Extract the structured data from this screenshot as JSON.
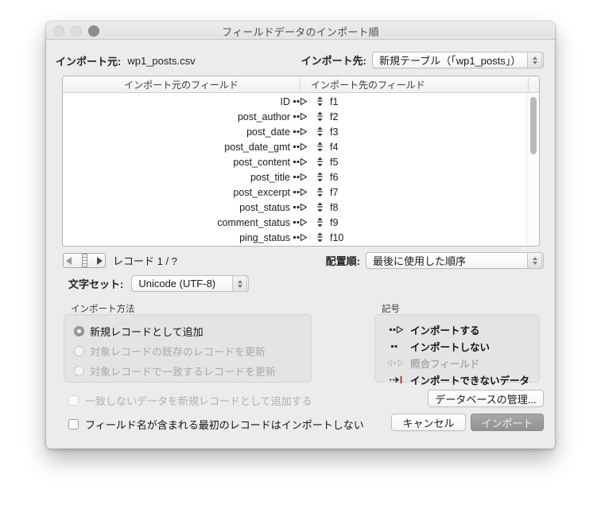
{
  "window": {
    "title": "フィールドデータのインポート順",
    "traffic_lights": [
      "close-button",
      "minimize-button",
      "zoom-button"
    ]
  },
  "source": {
    "label": "インポート元:",
    "value": "wp1_posts.csv"
  },
  "destination": {
    "label": "インポート先:",
    "value": "新規テーブル（「wp1_posts」）"
  },
  "field_list": {
    "header_source": "インポート元のフィールド",
    "header_target": "インポート先のフィールド",
    "rows": [
      {
        "source": "ID",
        "target": "f1"
      },
      {
        "source": "post_author",
        "target": "f2"
      },
      {
        "source": "post_date",
        "target": "f3"
      },
      {
        "source": "post_date_gmt",
        "target": "f4"
      },
      {
        "source": "post_content",
        "target": "f5"
      },
      {
        "source": "post_title",
        "target": "f6"
      },
      {
        "source": "post_excerpt",
        "target": "f7"
      },
      {
        "source": "post_status",
        "target": "f8"
      },
      {
        "source": "comment_status",
        "target": "f9"
      },
      {
        "source": "ping_status",
        "target": "f10"
      }
    ]
  },
  "navigation": {
    "prev_icon": "nav-previous-record-icon",
    "next_icon": "nav-next-record-icon",
    "record_label": "レコード 1 / ?"
  },
  "arrange": {
    "label": "配置順:",
    "value": "最後に使用した順序"
  },
  "charset": {
    "label": "文字セット:",
    "value": "Unicode (UTF-8)"
  },
  "import_method": {
    "title": "インポート方法",
    "options": [
      {
        "label": "新規レコードとして追加",
        "selected": true,
        "enabled": true
      },
      {
        "label": "対象レコードの既存のレコードを更新",
        "selected": false,
        "enabled": false
      },
      {
        "label": "対象レコードで一致するレコードを更新",
        "selected": false,
        "enabled": false
      }
    ]
  },
  "symbols": {
    "title": "記号",
    "items": [
      {
        "label": "インポートする",
        "icon": "import-arrow-icon",
        "enabled": true
      },
      {
        "label": "インポートしない",
        "icon": "no-import-dots-icon",
        "enabled": true
      },
      {
        "label": "照合フィールド",
        "icon": "match-field-icon",
        "enabled": false
      },
      {
        "label": "インポートできないデータ",
        "icon": "not-importable-data-icon",
        "enabled": true
      }
    ]
  },
  "checkboxes": [
    {
      "label": "一致しないデータを新規レコードとして追加する",
      "checked": false,
      "enabled": false
    },
    {
      "label": "フィールド名が含まれる最初のレコードはインポートしない",
      "checked": false,
      "enabled": true
    }
  ],
  "buttons": {
    "manage_database": "データベースの管理...",
    "cancel": "キャンセル",
    "import": "インポート"
  },
  "colors": {
    "dialog_background": "#ececec",
    "group_background": "#e4e4e4",
    "default_button": "#919191",
    "red_accent": "#cc2222",
    "disabled_text": "#a9a9a9"
  }
}
